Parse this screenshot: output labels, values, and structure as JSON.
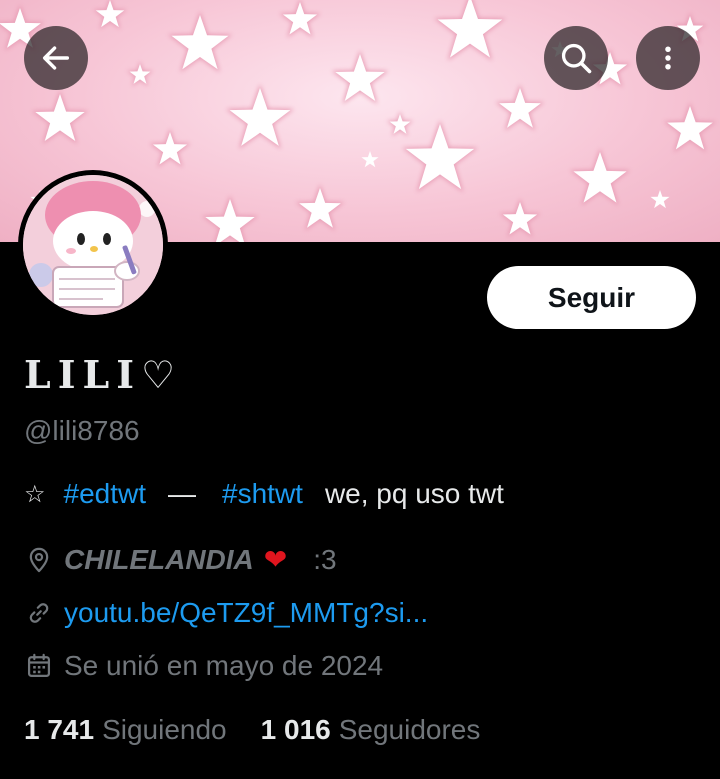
{
  "header": {
    "back_icon": "arrow-left-icon",
    "search_icon": "search-icon",
    "more_icon": "more-vertical-icon"
  },
  "profile": {
    "display_name": "LILI♡",
    "handle": "@lili8786",
    "follow_label": "Seguir",
    "bio": {
      "star": "☆",
      "tag1": "#edtwt",
      "dash": "—",
      "tag2": "#shtwt",
      "text": "we, pq uso twt"
    },
    "location": {
      "icon": "location-pin-icon",
      "text": "CHILELANDIA",
      "heart": "❤",
      "extra": ":3"
    },
    "link": {
      "icon": "link-icon",
      "text": "youtu.be/QeTZ9f_MMTg?si..."
    },
    "joined": {
      "icon": "calendar-icon",
      "text": "Se unió en mayo de 2024"
    },
    "following_count": "1 741",
    "following_label": "Siguiendo",
    "followers_count": "1 016",
    "followers_label": "Seguidores"
  },
  "colors": {
    "background": "#000000",
    "text_primary": "#e7e9ea",
    "text_secondary": "#71767b",
    "accent": "#1d9bf0",
    "heart": "#e0151e",
    "banner_pink": "#f7c6d6"
  }
}
